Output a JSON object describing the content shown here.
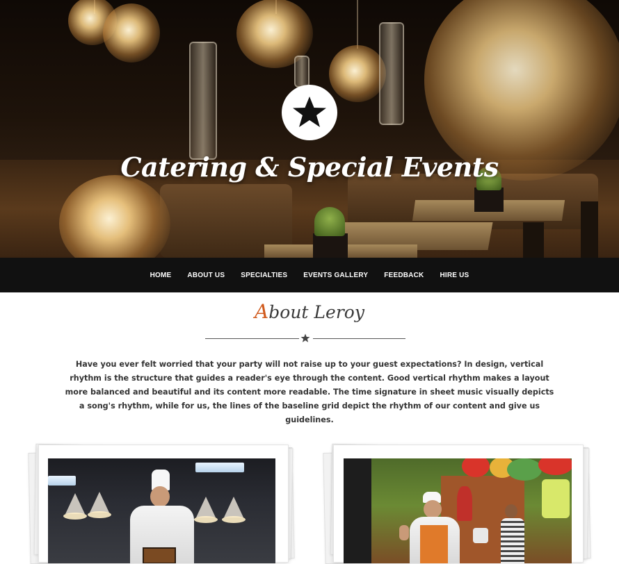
{
  "hero": {
    "title": "Catering & Special Events",
    "logo_icon": "star-icon"
  },
  "nav": {
    "items": [
      {
        "label": "HOME"
      },
      {
        "label": "ABOUT US"
      },
      {
        "label": "SPECIALTIES"
      },
      {
        "label": "EVENTS GALLERY"
      },
      {
        "label": "FEEDBACK"
      },
      {
        "label": "HIRE US"
      }
    ]
  },
  "about": {
    "title_first_letter": "A",
    "title_rest": "bout Leroy",
    "divider_icon": "star-icon",
    "text": "Have you ever felt worried that your party will not raise up to your guest expectations? In design, vertical rhythm is the structure that guides a reader's eye through the content. Good vertical rhythm makes a layout more balanced and beautiful and its content more readable. The time signature in sheet music visually depicts a song's rhythm, while for us, the lines of the baseline grid depict the rhythm of our content and give us guidelines."
  },
  "colors": {
    "accent": "#d05a1d",
    "nav_bg": "#111111",
    "text": "#333333"
  }
}
